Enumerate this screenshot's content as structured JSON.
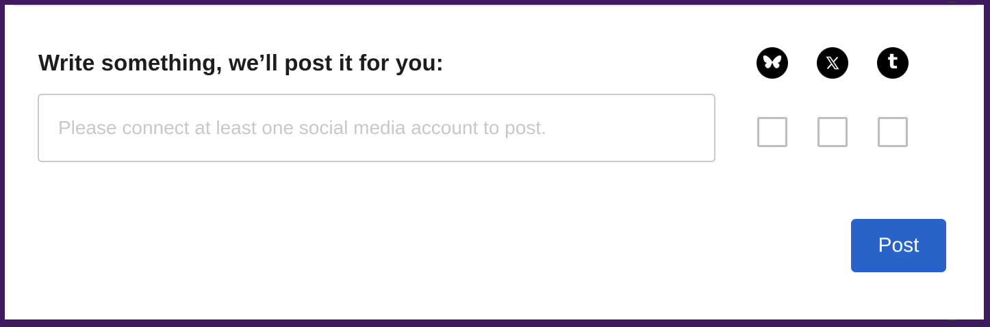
{
  "composer": {
    "prompt": "Write something, we’ll post it for you:",
    "input_value": "",
    "input_placeholder": "Please connect at least one social media account to post.",
    "post_label": "Post"
  },
  "networks": [
    {
      "icon": "bluesky-butterfly-icon",
      "checked": false
    },
    {
      "icon": "x-logo-icon",
      "checked": false
    },
    {
      "icon": "tumblr-t-icon",
      "checked": false
    }
  ],
  "colors": {
    "frame": "#3f1a5e",
    "button": "#2a63c8",
    "checkbox_border": "#bdbdbd",
    "input_border": "#c9c9c9"
  }
}
